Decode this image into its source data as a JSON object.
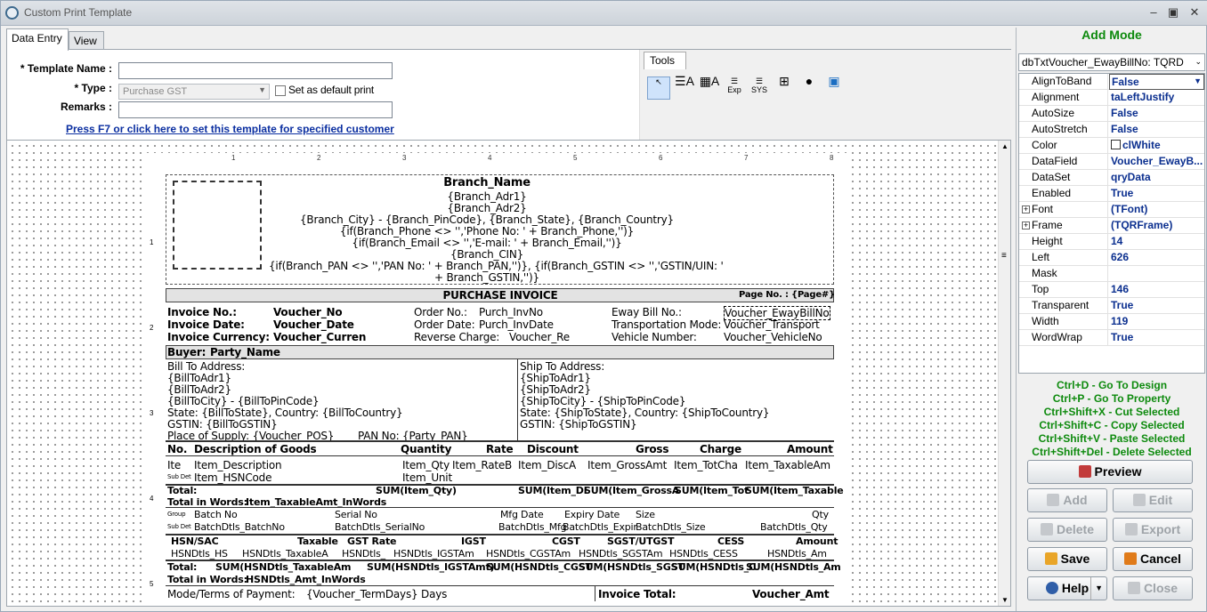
{
  "window": {
    "title": "Custom Print Template"
  },
  "tabs": [
    "Data Entry",
    "View"
  ],
  "form": {
    "template_name_label": "* Template Name :",
    "template_name_value": "",
    "type_label": "* Type :",
    "type_value": "Purchase GST",
    "default_label": "Set as default print",
    "remarks_label": "Remarks :",
    "remarks_value": "",
    "link": "Press F7 or click here to set this template for specified customer"
  },
  "tools": {
    "label": "Tools",
    "items": [
      "pointer-tool",
      "label-tool",
      "dbtext-tool",
      "expression-tool",
      "sysdata-tool",
      "rich-text-tool",
      "shape-tool",
      "image-tool"
    ]
  },
  "ruler": {
    "h": [
      "1",
      "2",
      "3",
      "4",
      "5",
      "6",
      "7",
      "8"
    ],
    "v": [
      "1",
      "2",
      "3",
      "4",
      "5"
    ]
  },
  "report": {
    "branch_name": "Branch_Name",
    "addr1": "{Branch_Adr1}",
    "addr2": "{Branch_Adr2}",
    "city_line": "{Branch_City} - {Branch_PinCode}, {Branch_State}, {Branch_Country}",
    "phone_line": "{if(Branch_Phone <> '','Phone No: ' + Branch_Phone,'')}",
    "email_line": "{if(Branch_Email <> '','E-mail: ' + Branch_Email,'')}",
    "cin": "{Branch_CIN}",
    "pan_line1": "{if(Branch_PAN <> '','PAN No: ' + Branch_PAN,'')}, {if(Branch_GSTIN <> '','GSTIN/UIN: '",
    "pan_line2": "+ Branch_GSTIN,'')}",
    "doc_title": "PURCHASE INVOICE",
    "page_no": "Page No. : {Page#}",
    "invoice_no_label": "Invoice No.:",
    "invoice_no": "Voucher_No",
    "invoice_date_label": "Invoice Date:",
    "invoice_date": "Voucher_Date",
    "currency_label": "Invoice Currency:",
    "currency": "Voucher_Curren",
    "order_no_label": "Order No.:",
    "order_no": "Purch_InvNo",
    "order_date_label": "Order Date:",
    "order_date": "Purch_InvDate",
    "reverse_label": "Reverse Charge:",
    "reverse": "Voucher_Re",
    "eway_label": "Eway Bill No.:",
    "eway": "Voucher_EwayBillNo",
    "transport_label": "Transportation Mode:",
    "transport": "Voucher_Transport",
    "vehicle_label": "Vehicle Number:",
    "vehicle": "Voucher_VehicleNo",
    "buyer_label": "Buyer:",
    "buyer": "Party_Name",
    "bill_to": [
      "Bill To Address:",
      "{BillToAdr1}",
      "{BillToAdr2}",
      "{BillToCity} - {BillToPinCode}",
      "State: {BillToState}, Country: {BillToCountry}",
      "GSTIN: {BillToGSTIN}"
    ],
    "place_supply": "Place of Supply: {Voucher_POS}",
    "pan_no": "PAN No: {Party_PAN}",
    "ship_to": [
      "Ship To Address:",
      "{ShipToAdr1}",
      "{ShipToAdr2}",
      "{ShipToCity} - {ShipToPinCode}",
      "State: {ShipToState}, Country: {ShipToCountry}",
      "GSTIN: {ShipToGSTIN}"
    ],
    "item_headers": [
      "No.",
      "Description of Goods",
      "Quantity",
      "Rate",
      "Discount",
      "Gross",
      "Charge",
      "Amount"
    ],
    "item_row1": [
      "Ite",
      "Item_Description",
      "Item_Qty",
      "Item_RateB",
      "Item_DiscA",
      "Item_GrossAmt",
      "Item_TotCha",
      "Item_TaxableAm"
    ],
    "subdet": "Sub Det",
    "item_hsn": "Item_HSNCode",
    "item_unit": "Item_Unit",
    "total_label": "Total:",
    "totals": [
      "SUM(Item_Qty)",
      "SUM(Item_Di",
      "SUM(Item_GrossA",
      "SUM(Item_Tot",
      "SUM(Item_Taxable"
    ],
    "total_words_label": "Total in Words:",
    "total_words": "Item_TaxableAmt_InWords",
    "group": "Group",
    "batch_headers": [
      "Batch No",
      "Serial No",
      "Mfg Date",
      "Expiry Date",
      "Size",
      "Qty"
    ],
    "batch_row": [
      "BatchDtls_BatchNo",
      "BatchDtls_SerialNo",
      "BatchDtls_Mfg",
      "BatchDtls_Expir",
      "BatchDtls_Size",
      "BatchDtls_Qty"
    ],
    "hsn_headers": [
      "HSN/SAC",
      "Taxable",
      "GST Rate",
      "IGST",
      "CGST",
      "SGST/UTGST",
      "CESS",
      "Amount"
    ],
    "hsn_row": [
      "HSNDtls_HS",
      "HSNDtls_TaxableA",
      "HSNDtls_",
      "HSNDtls_IGSTAm",
      "HSNDtls_CGSTAm",
      "HSNDtls_SGSTAm",
      "HSNDtls_CESS",
      "HSNDtls_Am"
    ],
    "hsn_totals": [
      "SUM(HSNDtls_TaxableAm",
      "SUM(HSNDtls_IGSTAmt)",
      "SUM(HSNDtls_CGST",
      "SUM(HSNDtls_SGST",
      "SUM(HSNDtls_C",
      "SUM(HSNDtls_Am"
    ],
    "hsn_words": "HSNDtls_Amt_InWords",
    "terms_label": "Mode/Terms of Payment:",
    "terms": "{Voucher_TermDays} Days",
    "inv_total_label": "Invoice Total:",
    "inv_total": "Voucher_Amt"
  },
  "right": {
    "mode": "Add Mode",
    "component": "dbTxtVoucher_EwayBillNo: TQRD",
    "props": [
      {
        "name": "AlignToBand",
        "value": "False"
      },
      {
        "name": "Alignment",
        "value": "taLeftJustify"
      },
      {
        "name": "AutoSize",
        "value": "False"
      },
      {
        "name": "AutoStretch",
        "value": "False"
      },
      {
        "name": "Color",
        "value": "clWhite"
      },
      {
        "name": "DataField",
        "value": "Voucher_EwayB..."
      },
      {
        "name": "DataSet",
        "value": "qryData"
      },
      {
        "name": "Enabled",
        "value": "True"
      },
      {
        "name": "Font",
        "value": "(TFont)"
      },
      {
        "name": "Frame",
        "value": "(TQRFrame)"
      },
      {
        "name": "Height",
        "value": "14"
      },
      {
        "name": "Left",
        "value": "626"
      },
      {
        "name": "Mask",
        "value": ""
      },
      {
        "name": "Top",
        "value": "146"
      },
      {
        "name": "Transparent",
        "value": "True"
      },
      {
        "name": "Width",
        "value": "119"
      },
      {
        "name": "WordWrap",
        "value": "True"
      }
    ],
    "shortcuts": [
      "Ctrl+D - Go To Design",
      "Ctrl+P - Go To Property",
      "Ctrl+Shift+X - Cut Selected",
      "Ctrl+Shift+C - Copy Selected",
      "Ctrl+Shift+V - Paste Selected",
      "Ctrl+Shift+Del - Delete Selected"
    ],
    "buttons": {
      "preview": "Preview",
      "add": "Add",
      "edit": "Edit",
      "delete": "Delete",
      "export": "Export",
      "save": "Save",
      "cancel": "Cancel",
      "help": "Help",
      "close": "Close"
    }
  }
}
